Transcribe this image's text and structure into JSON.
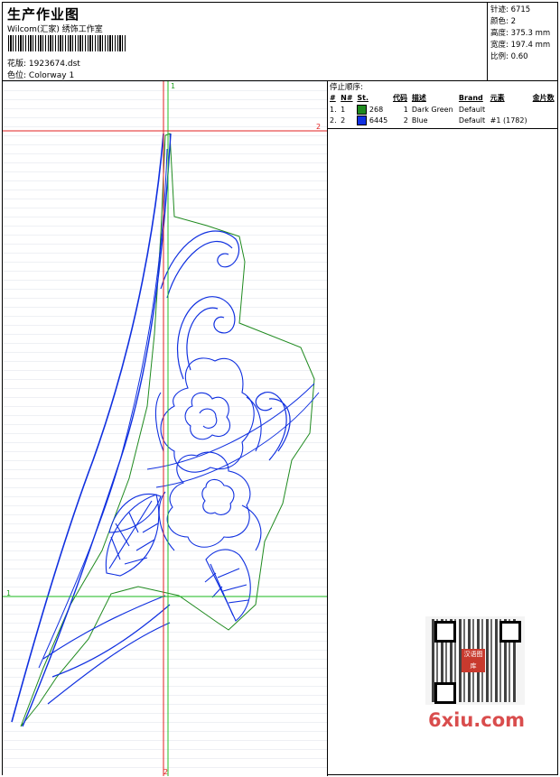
{
  "header": {
    "title": "生产作业图",
    "company": "Wilcom(汇家) 绣饰工作室",
    "design_label": "花版:",
    "design_value": "1923674.dst",
    "colorway_label": "色位:",
    "colorway_value": "Colorway 1"
  },
  "stats": [
    {
      "label": "针迹:",
      "value": "6715"
    },
    {
      "label": "颜色:",
      "value": "2"
    },
    {
      "label": "高度:",
      "value": "375.3 mm"
    },
    {
      "label": "宽度:",
      "value": "197.4 mm"
    },
    {
      "label": "比例:",
      "value": "0.60"
    }
  ],
  "guides": {
    "v_top": "1",
    "v_bottom": "2",
    "h_left": "1",
    "h_right": "2"
  },
  "color_table": {
    "title": "停止顺序:",
    "headers": [
      "#",
      "N#",
      "St.",
      "代码",
      "描述",
      "Brand",
      "元素",
      "金片数"
    ],
    "rows": [
      {
        "num": "1.",
        "n": "1",
        "swatch": "#1f8a1f",
        "stitches": "268",
        "code": "1",
        "desc": "Dark Green",
        "brand": "Default",
        "elements": "",
        "sequins": ""
      },
      {
        "num": "2.",
        "n": "2",
        "swatch": "#1030e0",
        "stitches": "6445",
        "code": "2",
        "desc": "Blue",
        "brand": "Default",
        "elements": "#1 (1782)",
        "sequins": ""
      }
    ]
  },
  "qr_badge": "汉语图库",
  "watermark": "6xiu.com",
  "colors": {
    "grid": "#eef0f4",
    "green": "#1f8a1f",
    "blue": "#1030e0",
    "guide_red": "#e02020",
    "guide_green": "#20c020",
    "brand": "#d94d4d"
  }
}
